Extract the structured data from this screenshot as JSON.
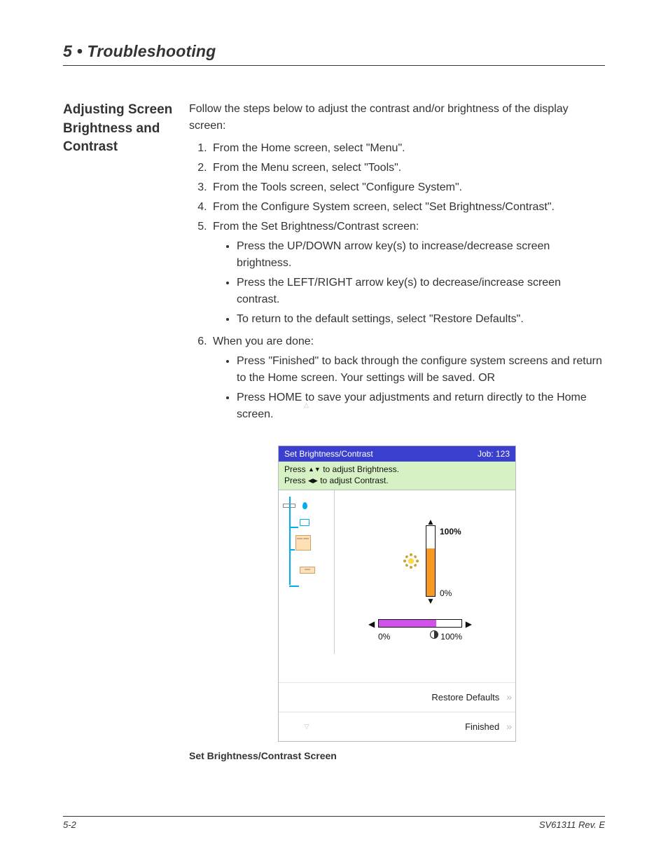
{
  "chapter_title": "5 • Troubleshooting",
  "side_heading": "Adjusting Screen Brightness and Contrast",
  "intro_text": "Follow the steps below to adjust the contrast and/or brightness of the display screen:",
  "steps": [
    "From the Home screen, select \"Menu\".",
    "From the Menu screen, select \"Tools\".",
    "From the Tools screen, select \"Configure System\".",
    "From the Configure System screen, select \"Set Brightness/Contrast\".",
    "From the Set Brightness/Contrast screen:",
    "When you are done:"
  ],
  "sub5": [
    "Press the UP/DOWN arrow key(s) to increase/decrease screen brightness.",
    "Press the LEFT/RIGHT arrow key(s) to decrease/increase screen contrast.",
    "To return to the default settings, select \"Restore Defaults\"."
  ],
  "sub6": [
    "Press \"Finished\" to back through the configure system screens and return to the Home screen. Your settings will be saved. OR",
    "Press HOME to save your adjustments and return directly to the Home screen."
  ],
  "device": {
    "title": "Set Brightness/Contrast",
    "job_label": "Job:  123",
    "instr_line1_a": "Press ",
    "instr_line1_b": " to adjust Brightness.",
    "instr_line2_a": "Press ",
    "instr_line2_b": " to adjust Contrast.",
    "brightness_max": "100%",
    "brightness_min": "0%",
    "contrast_min": "0%",
    "contrast_max": "100%",
    "action_restore": "Restore Defaults",
    "action_finished": "Finished"
  },
  "figure_caption": "Set Brightness/Contrast Screen",
  "footer_left": "5-2",
  "footer_right": "SV61311 Rev. E"
}
